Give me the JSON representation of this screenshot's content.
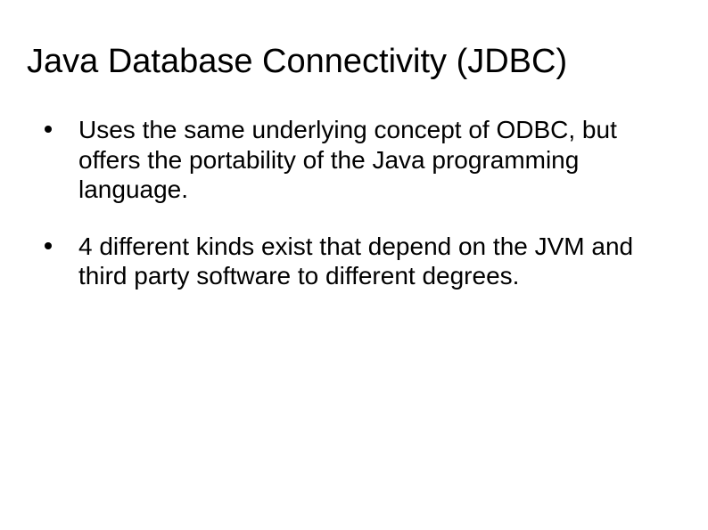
{
  "slide": {
    "title": "Java Database Connectivity (JDBC)",
    "bullets": [
      "Uses the same underlying concept of ODBC, but offers the portability of the Java programming language.",
      "4 different kinds exist that depend on the JVM and third party software to different degrees."
    ]
  }
}
